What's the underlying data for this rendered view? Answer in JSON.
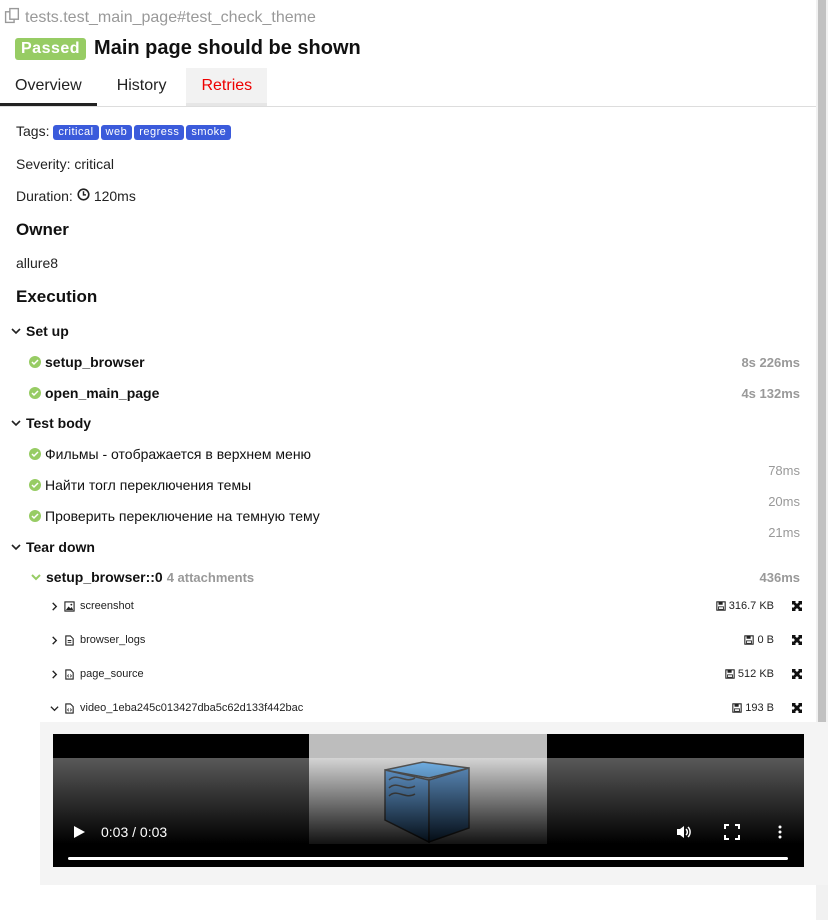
{
  "header": {
    "path": "tests.test_main_page#test_check_theme",
    "status": "Passed",
    "title": "Main page should be shown"
  },
  "tabs": [
    "Overview",
    "History",
    "Retries"
  ],
  "overview": {
    "tags_label": "Tags:",
    "tags": [
      "critical",
      "web",
      "regress",
      "smoke"
    ],
    "severity": "Severity: critical",
    "duration_label": "Duration:",
    "duration_value": "120ms",
    "owner_title": "Owner",
    "owner": "allure8",
    "execution_title": "Execution"
  },
  "setup": {
    "title": "Set up",
    "steps": [
      {
        "name": "setup_browser",
        "duration": "8s 226ms"
      },
      {
        "name": "open_main_page",
        "duration": "4s 132ms"
      }
    ]
  },
  "body": {
    "title": "Test body",
    "steps": [
      {
        "name": "Фильмы - отображается в верхнем меню",
        "duration": "78ms"
      },
      {
        "name": "Найти тогл переключения темы",
        "duration": "20ms"
      },
      {
        "name": "Проверить переключение на темную тему",
        "duration": "21ms"
      }
    ]
  },
  "teardown": {
    "title": "Tear down",
    "step_name": "setup_browser::0",
    "attachments_count": "4 attachments",
    "duration": "436ms",
    "attachments": [
      {
        "name": "screenshot",
        "size": "316.7 KB",
        "icon": "image-icon"
      },
      {
        "name": "browser_logs",
        "size": "0 B",
        "icon": "text-file-icon"
      },
      {
        "name": "page_source",
        "size": "512 KB",
        "icon": "code-file-icon"
      },
      {
        "name": "video_1eba245c013427dba5c62d133f442bac",
        "size": "193 B",
        "icon": "code-file-icon"
      }
    ]
  },
  "video": {
    "time": "0:03 / 0:03",
    "progress": 1.0
  },
  "colors": {
    "passed": "#97cc64",
    "tag": "#3b5bdb",
    "retries": "#ee0000"
  }
}
